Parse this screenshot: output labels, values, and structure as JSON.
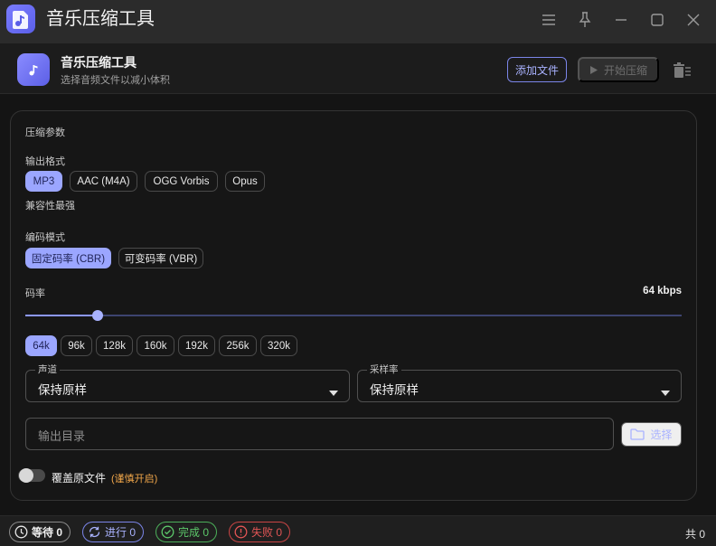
{
  "window": {
    "title": "音乐压缩工具",
    "controls": [
      "menu-icon",
      "pin-icon",
      "minimize-icon",
      "maximize-icon",
      "close-icon"
    ]
  },
  "header": {
    "title": "音乐压缩工具",
    "subtitle": "选择音频文件以减小体积",
    "add_file_label": "添加文件",
    "start_label": "开始压缩"
  },
  "params": {
    "section_title": "压缩参数",
    "format": {
      "label": "输出格式",
      "options": [
        "MP3",
        "AAC (M4A)",
        "OGG Vorbis",
        "Opus"
      ],
      "selected": "MP3",
      "hint": "兼容性最强"
    },
    "mode": {
      "label": "编码模式",
      "options": [
        "固定码率 (CBR)",
        "可变码率 (VBR)"
      ],
      "selected": "固定码率 (CBR)"
    },
    "bitrate": {
      "label": "码率",
      "value_text": "64 kbps",
      "value": 64,
      "min": 64,
      "max": 320,
      "presets": [
        "64k",
        "96k",
        "128k",
        "160k",
        "192k",
        "256k",
        "320k"
      ],
      "selected": "64k",
      "slider_fraction": 0.11
    },
    "channel": {
      "label": "声道",
      "value": "保持原样"
    },
    "sample_rate": {
      "label": "采样率",
      "value": "保持原样"
    },
    "output_dir": {
      "placeholder": "输出目录",
      "choose_label": "选择"
    },
    "overwrite": {
      "label": "覆盖原文件",
      "warning": "(谨慎开启)",
      "enabled": false
    }
  },
  "footer": {
    "waiting": "等待 0",
    "running": "进行 0",
    "done": "完成 0",
    "failed": "失败 0",
    "total": "共 0"
  },
  "colors": {
    "accent": "#9ba6ff",
    "warning": "#f0a64a",
    "success": "#5cc86a",
    "error": "#e25555"
  }
}
